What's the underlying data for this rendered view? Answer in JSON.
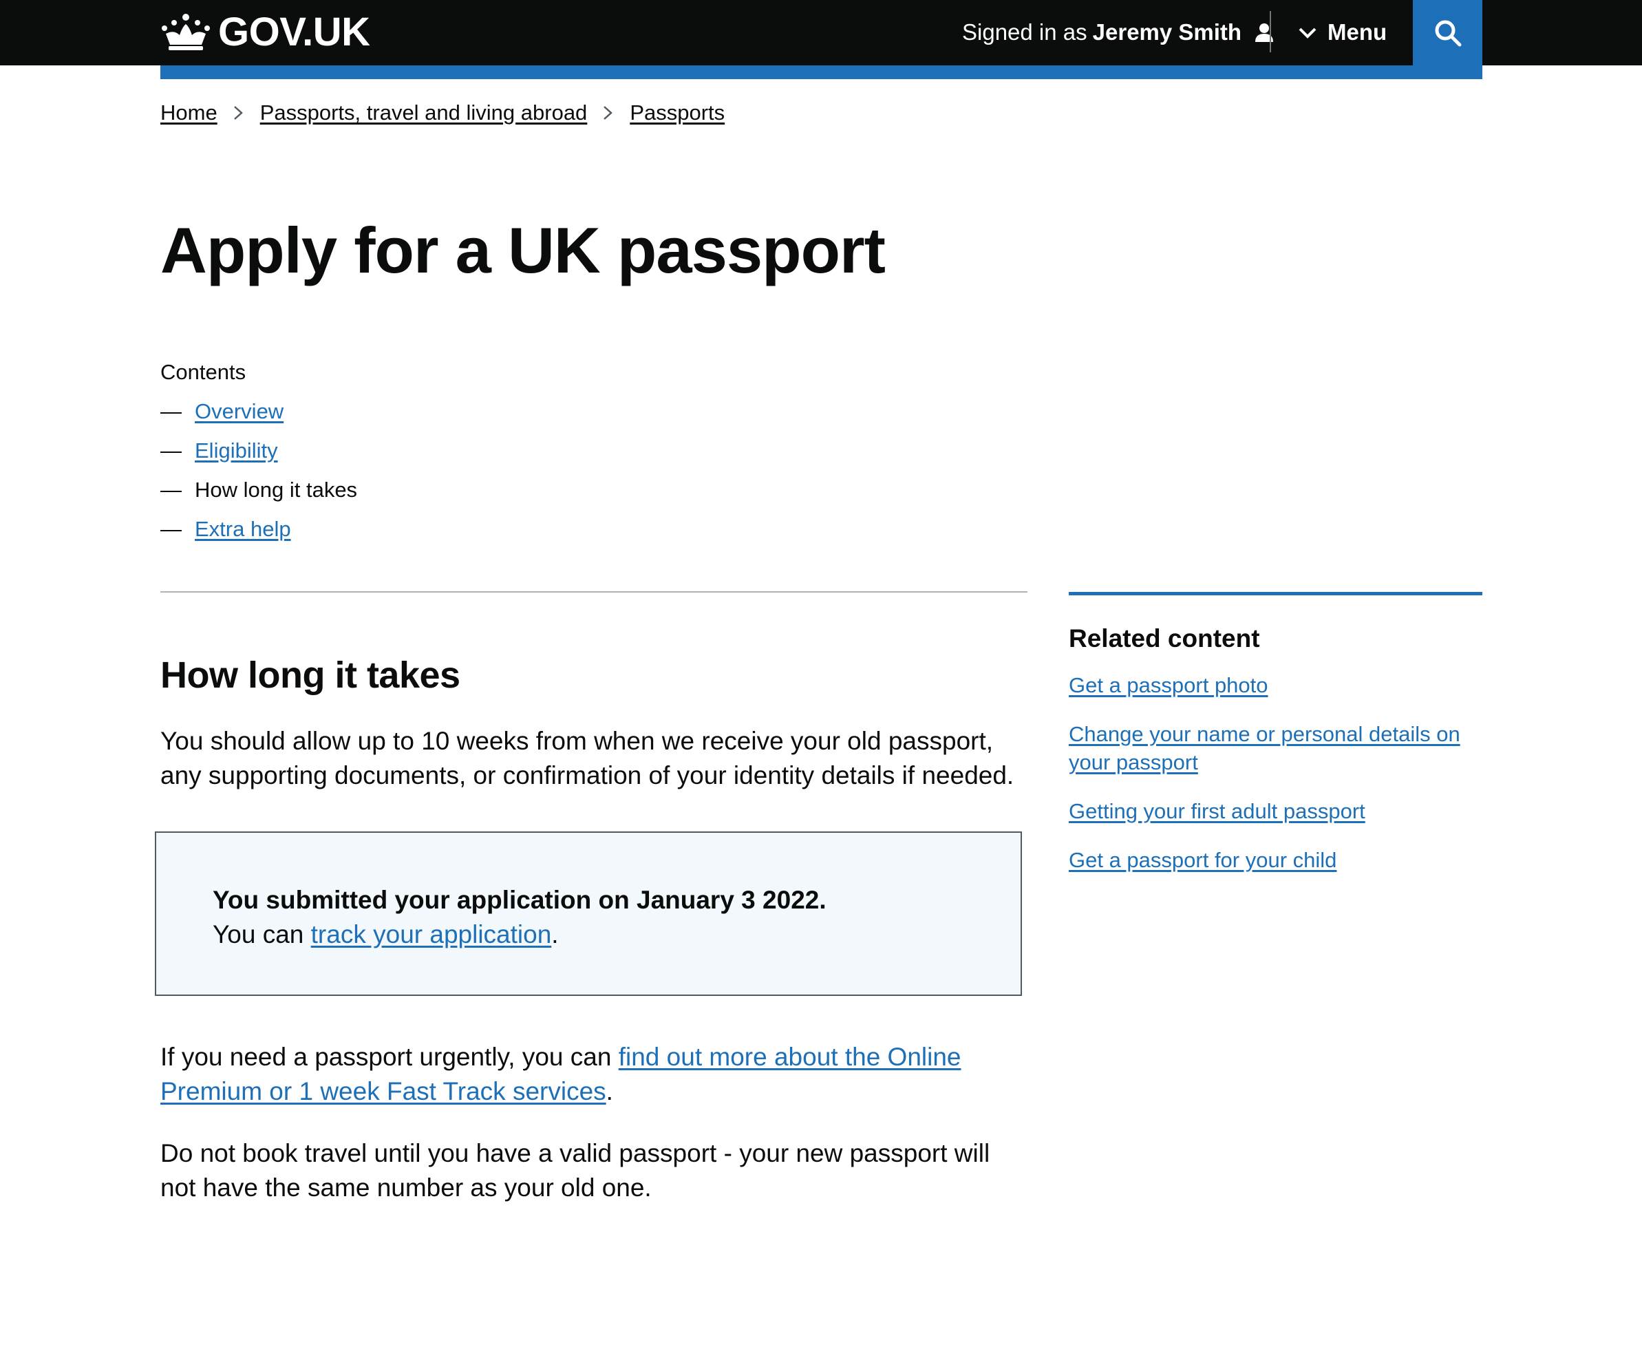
{
  "header": {
    "logo_text": "GOV.UK",
    "signed_in_prefix": "Signed in as",
    "user_name": "Jeremy Smith",
    "menu_label": "Menu",
    "accent_color": "#1d70b8",
    "background_color": "#0b0c0c"
  },
  "breadcrumb": [
    "Home",
    "Passports, travel and living abroad",
    "Passports"
  ],
  "page_title": "Apply for a UK passport",
  "contents": {
    "label": "Contents",
    "items": [
      {
        "label": "Overview",
        "is_link": true
      },
      {
        "label": "Eligibility",
        "is_link": true
      },
      {
        "label": "How long it takes",
        "is_link": false
      },
      {
        "label": "Extra help",
        "is_link": true
      }
    ]
  },
  "section": {
    "heading": "How long it takes",
    "p1": "You should allow up to 10 weeks from when we receive your old passport, any supporting documents, or confirmation of your identity details if needed.",
    "notice_strong": "You submitted your application on January 3 2022.",
    "notice_prefix": "You can ",
    "notice_link": "track your application",
    "notice_suffix": ".",
    "p2_prefix": "If you need a passport urgently, you can ",
    "p2_link": "find out more about the Online Premium or 1 week Fast Track services",
    "p2_suffix": ".",
    "p3": "Do not book travel until you have a valid passport - your new passport will not have the same number as your old one."
  },
  "related": {
    "title": "Related content",
    "links": [
      "Get a passport photo",
      "Change your name or personal details on your passport",
      "Getting your first adult passport",
      "Get a passport for your child"
    ]
  },
  "icons": [
    "crown-icon",
    "user-icon",
    "chevron-down-icon",
    "search-icon",
    "chevron-right-icon"
  ]
}
